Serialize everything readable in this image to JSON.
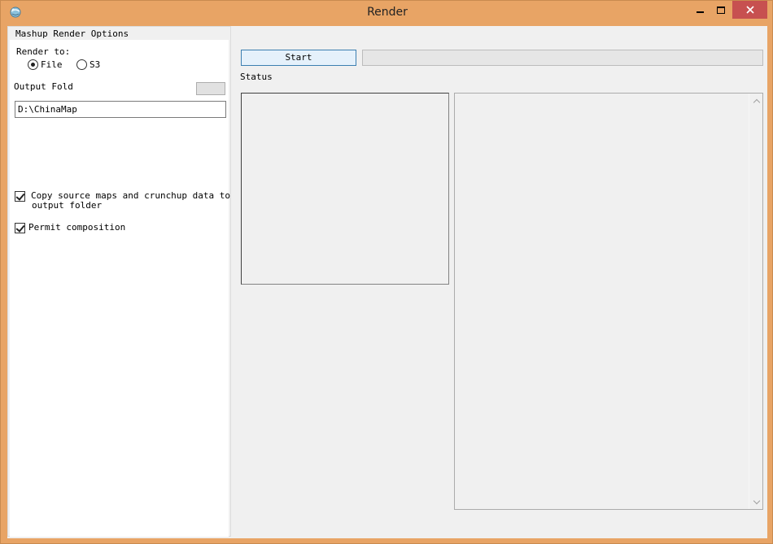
{
  "window": {
    "title": "Render",
    "icons": {
      "app": "globe-app-icon",
      "minimize": "minimize-icon",
      "maximize": "maximize-icon",
      "close": "close-icon"
    },
    "close_color": "#c75050",
    "frame_color": "#e8a465"
  },
  "options": {
    "group_title": "Mashup Render Options",
    "render_to_label": "Render to:",
    "render_targets": [
      {
        "label": "File",
        "checked": true
      },
      {
        "label": "S3",
        "checked": false
      }
    ],
    "output_folder_label": "Output Fold",
    "output_folder_value": "D:\\ChinaMap",
    "copy_source_label_line1": "Copy source maps and crunchup data to",
    "copy_source_label_line2": "output folder",
    "copy_source_checked": true,
    "permit_composition_label": "Permit composition",
    "permit_composition_checked": true
  },
  "controls": {
    "start_label": "Start",
    "progress_percent": 0,
    "status_label": "Status"
  }
}
